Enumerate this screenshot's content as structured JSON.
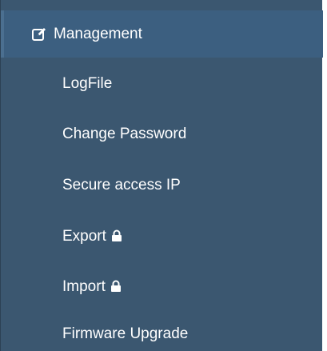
{
  "sidebar": {
    "section": {
      "label": "Management",
      "icon": "edit-icon"
    },
    "items": [
      {
        "label": "LogFile",
        "locked": false
      },
      {
        "label": "Change Password",
        "locked": false
      },
      {
        "label": "Secure access IP",
        "locked": false
      },
      {
        "label": "Export",
        "locked": true,
        "icon": "lock-icon"
      },
      {
        "label": "Import",
        "locked": true,
        "icon": "lock-icon"
      },
      {
        "label": "Firmware Upgrade",
        "locked": false
      }
    ]
  },
  "colors": {
    "sidebar_bg": "#3b5770",
    "header_bg": "#3c5f80",
    "text": "#ffffff"
  }
}
